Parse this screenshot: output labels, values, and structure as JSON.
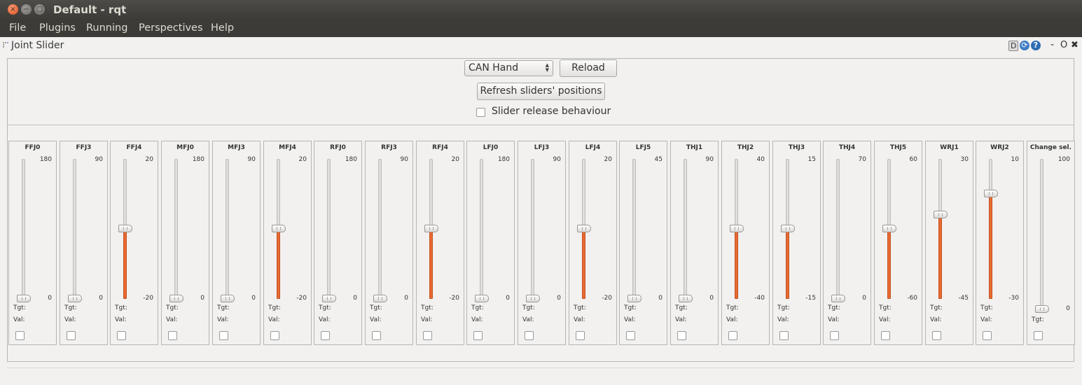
{
  "window": {
    "title": "Default - rqt",
    "close_glyph": "×",
    "min_glyph": "−",
    "max_glyph": "□"
  },
  "menu": {
    "items": [
      "File",
      "Plugins",
      "Running",
      "Perspectives",
      "Help"
    ]
  },
  "plugin": {
    "title": "Joint Slider",
    "header_icons": {
      "d": "D",
      "reload": "⟳",
      "help": "?",
      "minimize": "-",
      "float": "O",
      "close": "✖"
    }
  },
  "controls": {
    "hand_select": "CAN Hand",
    "reload_label": "Reload",
    "refresh_label": "Refresh sliders' positions",
    "release_label": "Slider release behaviour"
  },
  "labels": {
    "tgt": "Tgt:",
    "val": "Val:"
  },
  "joints": [
    {
      "name": "FFJ0",
      "max": "180",
      "min": "0",
      "level": 0.0,
      "filled": false
    },
    {
      "name": "FFJ3",
      "max": "90",
      "min": "0",
      "level": 0.0,
      "filled": false
    },
    {
      "name": "FFJ4",
      "max": "20",
      "min": "-20",
      "level": 0.5,
      "filled": true
    },
    {
      "name": "MFJ0",
      "max": "180",
      "min": "0",
      "level": 0.0,
      "filled": false
    },
    {
      "name": "MFJ3",
      "max": "90",
      "min": "0",
      "level": 0.0,
      "filled": false
    },
    {
      "name": "MFJ4",
      "max": "20",
      "min": "-20",
      "level": 0.5,
      "filled": true
    },
    {
      "name": "RFJ0",
      "max": "180",
      "min": "0",
      "level": 0.0,
      "filled": false
    },
    {
      "name": "RFJ3",
      "max": "90",
      "min": "0",
      "level": 0.0,
      "filled": false
    },
    {
      "name": "RFJ4",
      "max": "20",
      "min": "-20",
      "level": 0.5,
      "filled": true
    },
    {
      "name": "LFJ0",
      "max": "180",
      "min": "0",
      "level": 0.0,
      "filled": false
    },
    {
      "name": "LFJ3",
      "max": "90",
      "min": "0",
      "level": 0.0,
      "filled": false
    },
    {
      "name": "LFJ4",
      "max": "20",
      "min": "-20",
      "level": 0.5,
      "filled": true
    },
    {
      "name": "LFJ5",
      "max": "45",
      "min": "0",
      "level": 0.0,
      "filled": false
    },
    {
      "name": "THJ1",
      "max": "90",
      "min": "0",
      "level": 0.0,
      "filled": false
    },
    {
      "name": "THJ2",
      "max": "40",
      "min": "-40",
      "level": 0.5,
      "filled": true
    },
    {
      "name": "THJ3",
      "max": "15",
      "min": "-15",
      "level": 0.5,
      "filled": true
    },
    {
      "name": "THJ4",
      "max": "70",
      "min": "0",
      "level": 0.0,
      "filled": false
    },
    {
      "name": "THJ5",
      "max": "60",
      "min": "-60",
      "level": 0.5,
      "filled": true
    },
    {
      "name": "WRJ1",
      "max": "30",
      "min": "-45",
      "level": 0.6,
      "filled": true
    },
    {
      "name": "WRJ2",
      "max": "10",
      "min": "-30",
      "level": 0.75,
      "filled": true
    },
    {
      "name": "Change sel.",
      "max": "100",
      "min": "0",
      "level": 0.0,
      "filled": false,
      "special": true
    }
  ]
}
